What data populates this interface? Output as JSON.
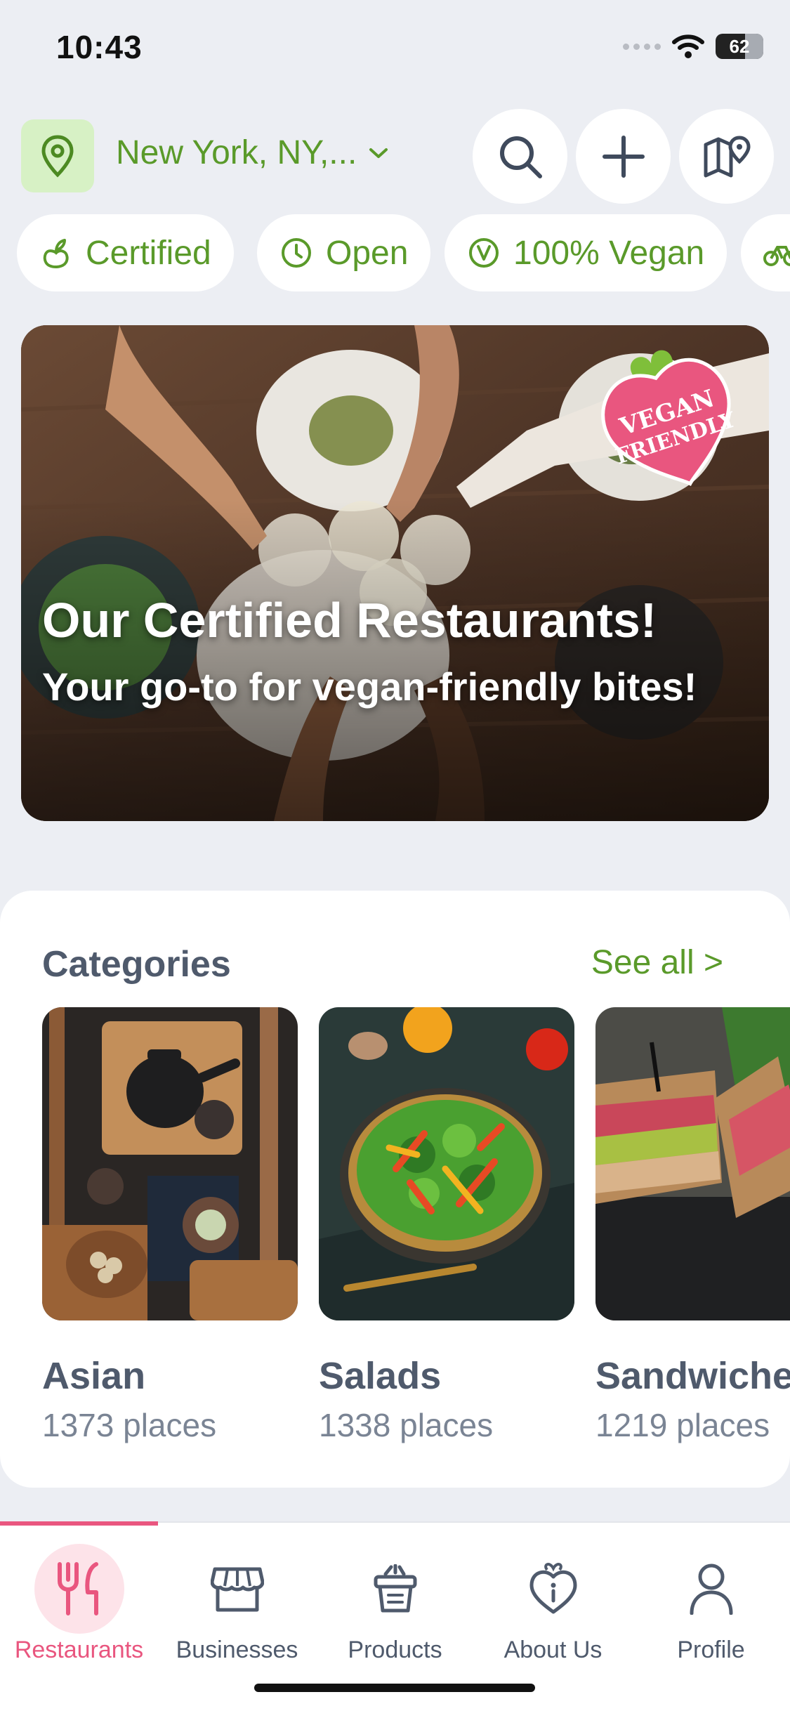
{
  "status": {
    "time": "10:43",
    "battery": "62"
  },
  "header": {
    "location": "New York, NY,..."
  },
  "filters": [
    {
      "label": "Certified",
      "icon": "sprout-icon"
    },
    {
      "label": "Open",
      "icon": "clock-icon"
    },
    {
      "label": "100% Vegan",
      "icon": "vegan-v-icon"
    },
    {
      "label": "",
      "icon": "bicycle-icon"
    }
  ],
  "hero": {
    "title": "Our Certified Restaurants!",
    "subtitle": "Your go-to for vegan-friendly bites!",
    "badge_line1": "VEGAN",
    "badge_line2": "FRIENDLY"
  },
  "categories": {
    "heading": "Categories",
    "see_all": "See all >",
    "items": [
      {
        "name": "Asian",
        "count": "1373 places"
      },
      {
        "name": "Salads",
        "count": "1338 places"
      },
      {
        "name": "Sandwiches",
        "count": "1219 places"
      }
    ]
  },
  "tabs": [
    {
      "label": "Restaurants",
      "icon": "fork-knife-icon",
      "active": true
    },
    {
      "label": "Businesses",
      "icon": "storefront-icon",
      "active": false
    },
    {
      "label": "Products",
      "icon": "grocery-bag-icon",
      "active": false
    },
    {
      "label": "About Us",
      "icon": "heart-info-icon",
      "active": false
    },
    {
      "label": "Profile",
      "icon": "person-icon",
      "active": false
    }
  ],
  "colors": {
    "brand_green": "#5a9a2a",
    "brand_pink": "#e9567f",
    "background": "#eceef3"
  }
}
